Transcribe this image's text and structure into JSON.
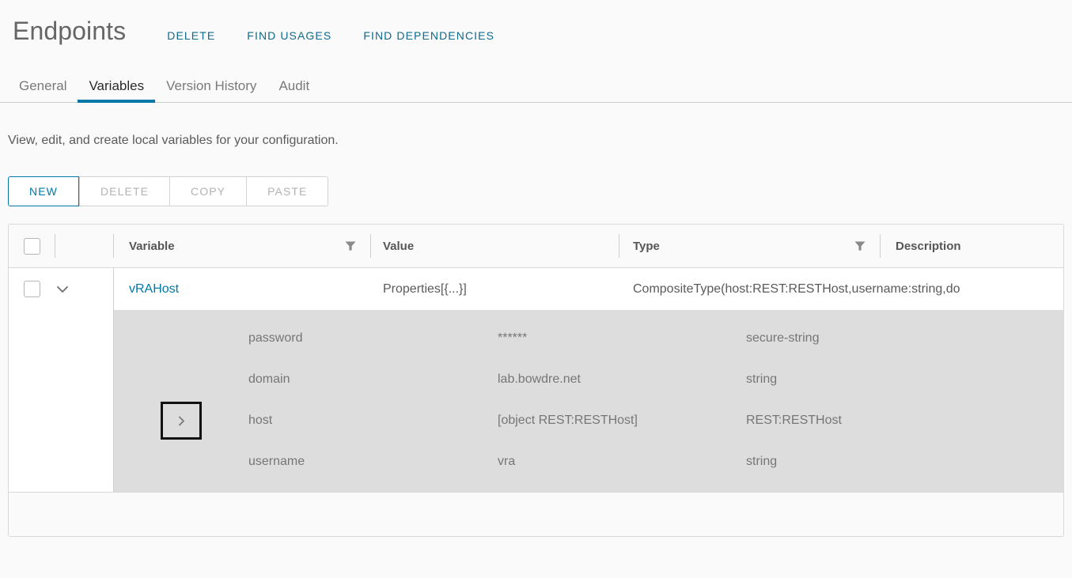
{
  "header": {
    "title": "Endpoints",
    "actions": [
      {
        "label": "DELETE",
        "name": "delete"
      },
      {
        "label": "FIND USAGES",
        "name": "find-usages"
      },
      {
        "label": "FIND DEPENDENCIES",
        "name": "find-dependencies"
      }
    ]
  },
  "tabs": [
    {
      "label": "General",
      "active": false
    },
    {
      "label": "Variables",
      "active": true
    },
    {
      "label": "Version History",
      "active": false
    },
    {
      "label": "Audit",
      "active": false
    }
  ],
  "section": {
    "description": "View, edit, and create local variables for your configuration."
  },
  "toolbar": {
    "new_label": "NEW",
    "delete_label": "DELETE",
    "copy_label": "COPY",
    "paste_label": "PASTE"
  },
  "table": {
    "columns": {
      "variable": "Variable",
      "value": "Value",
      "type": "Type",
      "description": "Description"
    },
    "rows": [
      {
        "variable": "vRAHost",
        "value": "Properties[{...}]",
        "type": "CompositeType(host:REST:RESTHost,username:string,do",
        "description": "",
        "expanded": true,
        "children": [
          {
            "name": "password",
            "value": "******",
            "type": "secure-string",
            "expandable": false,
            "focused": false
          },
          {
            "name": "domain",
            "value": "lab.bowdre.net",
            "type": "string",
            "expandable": false,
            "focused": false
          },
          {
            "name": "host",
            "value": "[object REST:RESTHost]",
            "type": "REST:RESTHost",
            "expandable": true,
            "focused": true
          },
          {
            "name": "username",
            "value": "vra",
            "type": "string",
            "expandable": false,
            "focused": false
          }
        ]
      }
    ]
  },
  "colors": {
    "accent": "#0079a8",
    "link": "#0f6a8e",
    "subrow_bg": "#dddddd",
    "text": "#565656"
  }
}
